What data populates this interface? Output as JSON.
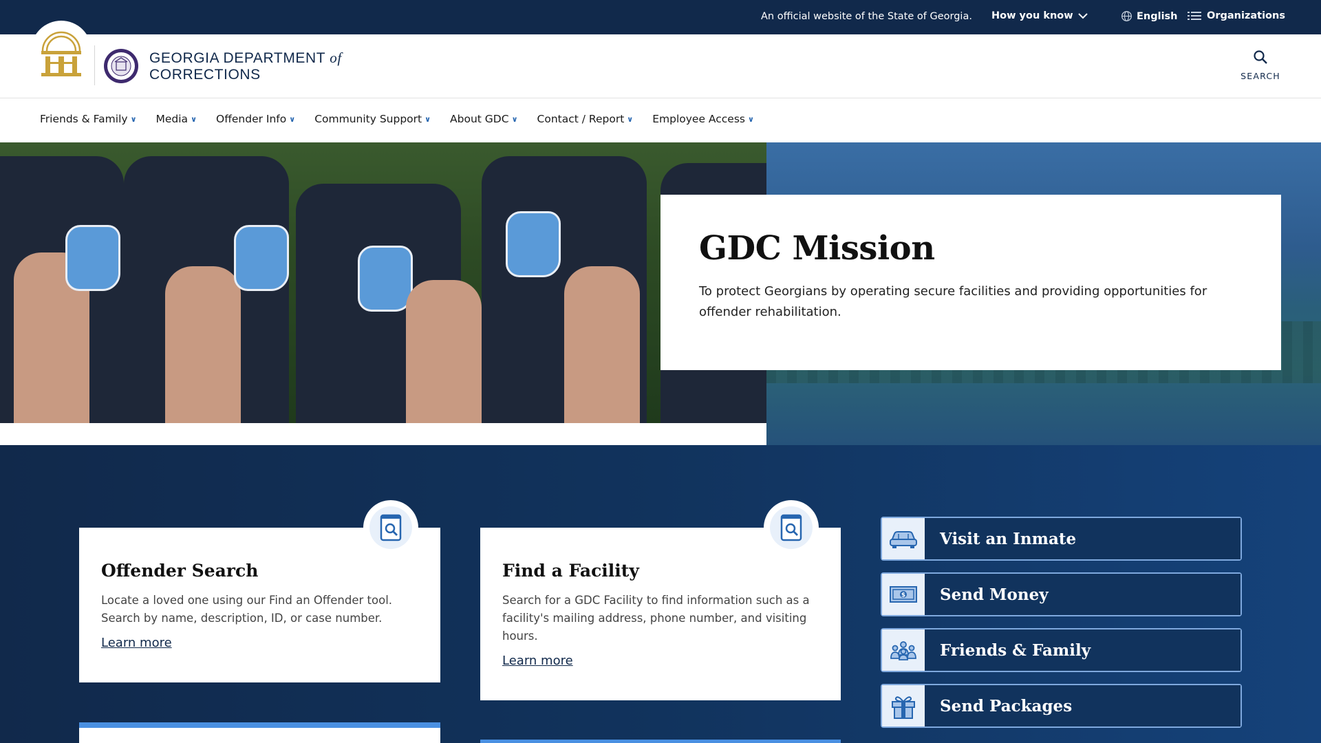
{
  "colors": {
    "navy": "#11294b",
    "accent_blue": "#2766b0",
    "light_blue": "#e8f0fa"
  },
  "topbar": {
    "official_text": "An official website of the State of Georgia.",
    "how_you_know": "How you know",
    "language": "English",
    "organizations": "Organizations"
  },
  "header": {
    "brand_line1": "GEORGIA DEPARTMENT",
    "brand_of": "of",
    "brand_line2": "CORRECTIONS",
    "search_label": "SEARCH"
  },
  "nav": {
    "items": [
      {
        "label": "Friends & Family"
      },
      {
        "label": "Media"
      },
      {
        "label": "Offender Info"
      },
      {
        "label": "Community Support"
      },
      {
        "label": "About GDC"
      },
      {
        "label": "Contact / Report"
      },
      {
        "label": "Employee Access"
      }
    ]
  },
  "hero": {
    "title": "GDC Mission",
    "body": "To protect Georgians by operating secure facilities and providing opportunities for offender rehabilitation."
  },
  "cards": [
    {
      "title": "Offender Search",
      "body": "Locate a loved one using our Find an Offender tool. Search by name, description, ID, or case number.",
      "link": "Learn more",
      "icon": "document-search-icon"
    },
    {
      "title": "Find a Facility",
      "body": "Search for a GDC Facility to find information such as a facility's mailing address, phone number, and visiting hours.",
      "link": "Learn more",
      "icon": "document-search-icon"
    }
  ],
  "quick_links": [
    {
      "label": "Visit an Inmate",
      "icon": "car-icon"
    },
    {
      "label": "Send Money",
      "icon": "money-icon"
    },
    {
      "label": "Friends & Family",
      "icon": "people-icon"
    },
    {
      "label": "Send Packages",
      "icon": "gift-icon"
    }
  ]
}
